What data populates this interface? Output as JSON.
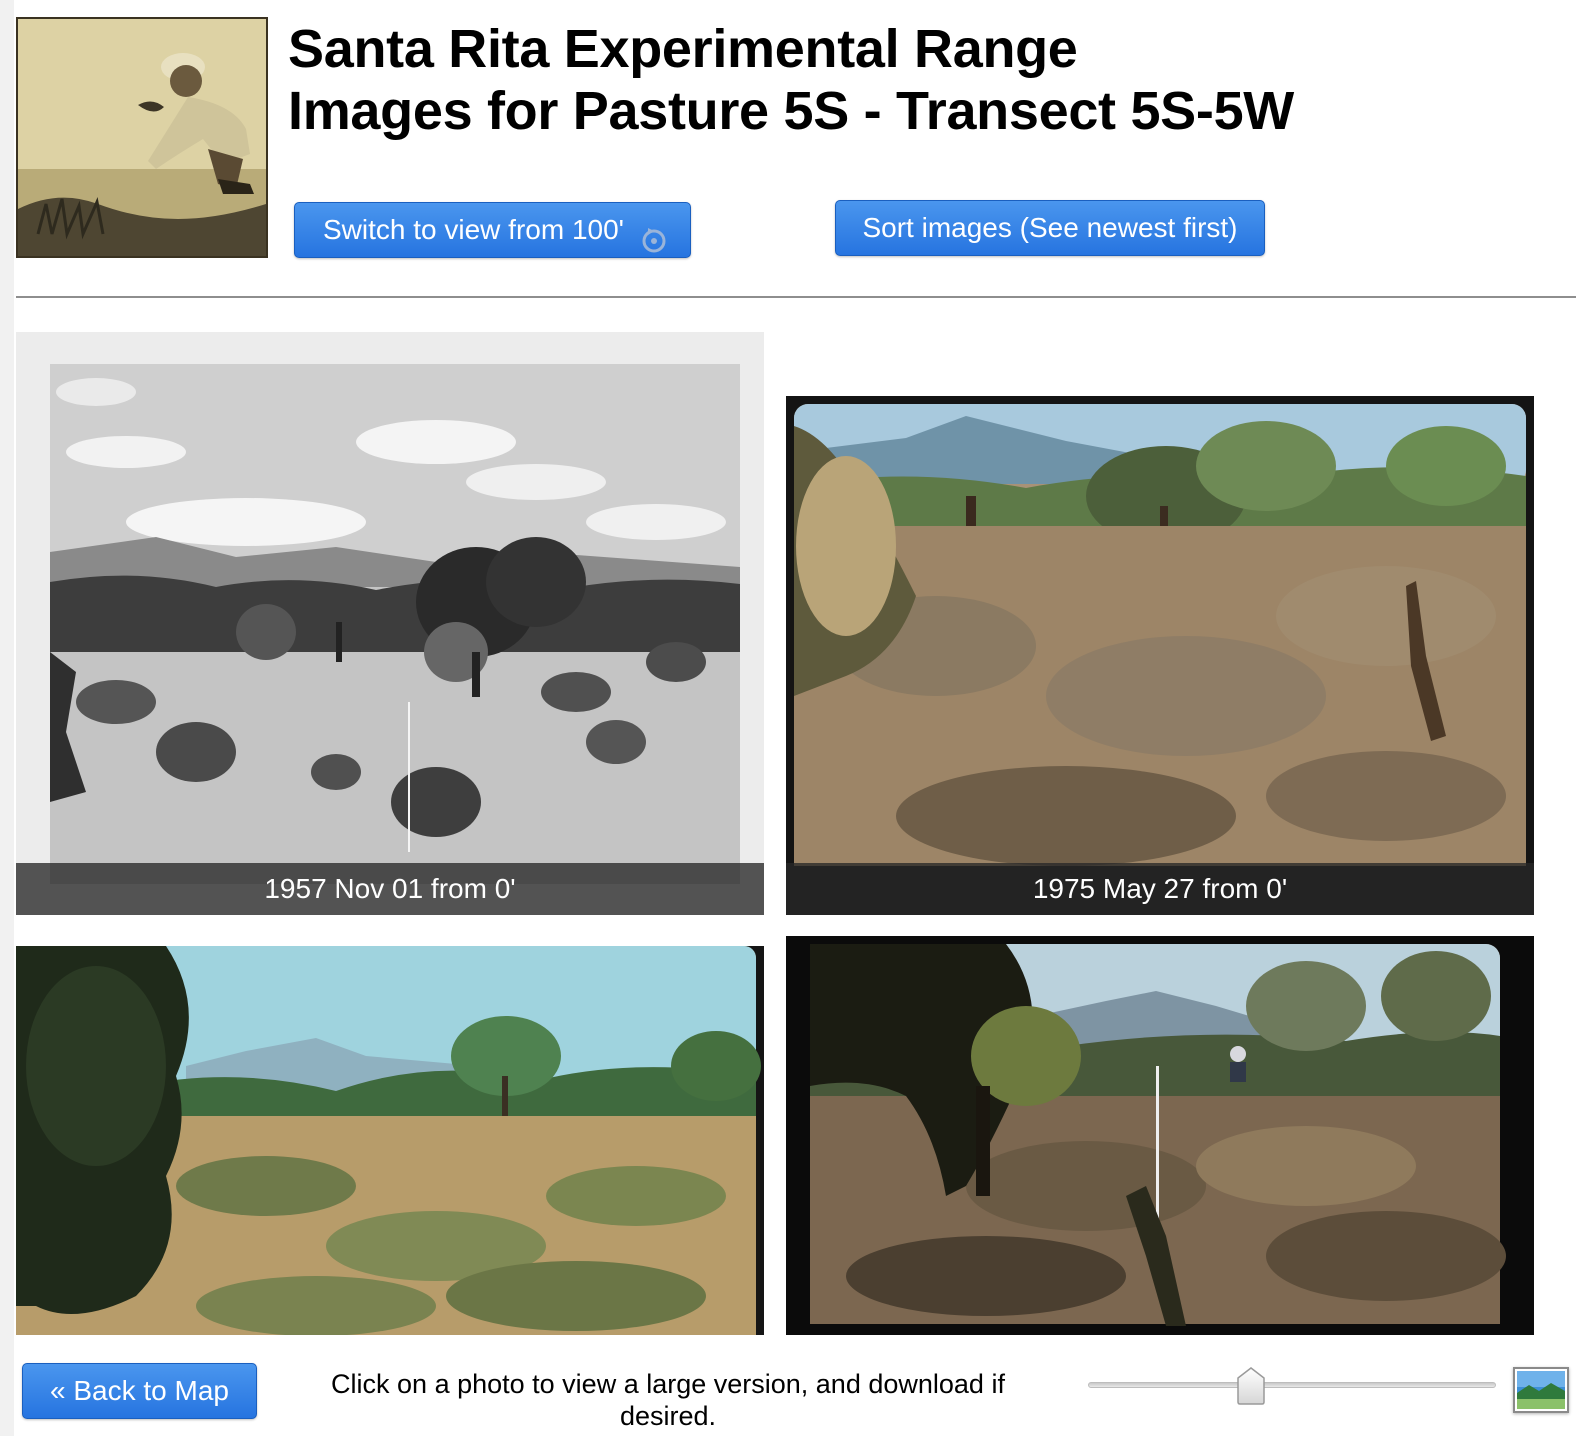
{
  "header": {
    "title_line1": "Santa Rita Experimental Range",
    "title_line2": "Images for Pasture 5S - Transect 5S-5W",
    "logo_icon": "kneeling-scientist-photo"
  },
  "toolbar": {
    "switch_view_label": "Switch to view from 100'",
    "switch_view_icon": "refresh-icon",
    "sort_label": "Sort images (See newest first)"
  },
  "gallery": {
    "photos": [
      {
        "caption": "1957 Nov 01 from 0'",
        "style": "black-and-white"
      },
      {
        "caption": "1975 May 27 from 0'",
        "style": "color"
      },
      {
        "caption": "",
        "style": "color"
      },
      {
        "caption": "",
        "style": "color"
      }
    ]
  },
  "footer": {
    "back_label": "« Back to Map",
    "instructions": "Click on a photo to view a large version, and download if desired.",
    "zoom_slider_value": 0.4,
    "size_icon": "landscape-image-icon"
  },
  "colors": {
    "button_blue": "#2f7fe6",
    "caption_bar": "#282828",
    "rule": "#8e8e8e"
  }
}
